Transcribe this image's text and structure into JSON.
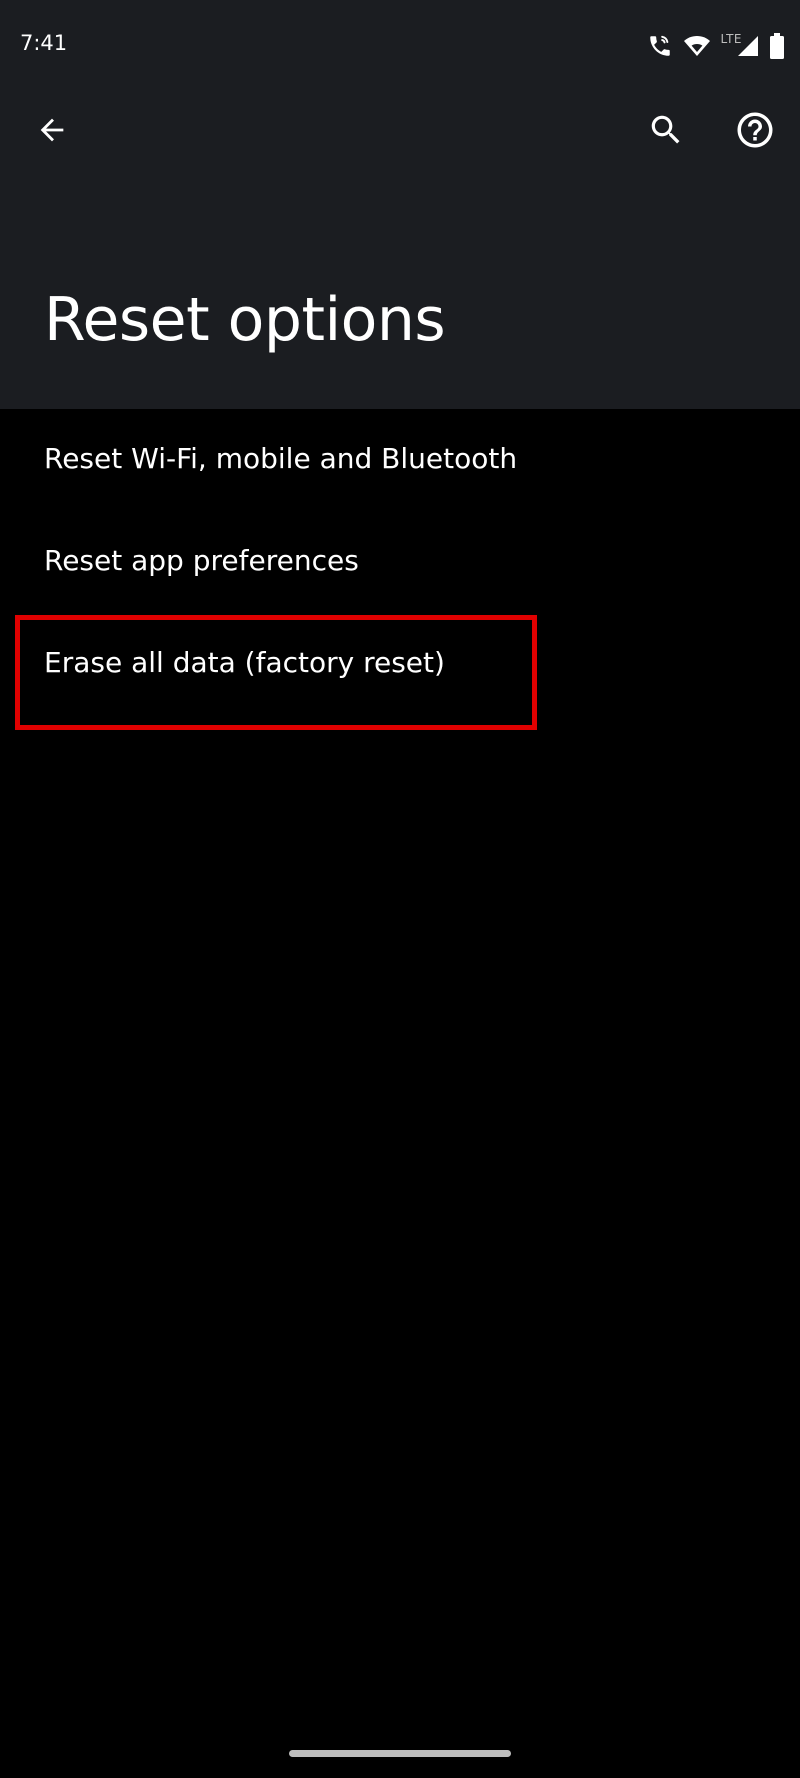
{
  "status_bar": {
    "time": "7:41",
    "network_type": "LTE",
    "icons": [
      "wifi-calling-icon",
      "wifi-icon",
      "cell-signal-icon",
      "battery-icon"
    ]
  },
  "toolbar": {
    "back_icon": "arrow-left-icon",
    "search_icon": "search-icon",
    "help_icon": "help-circle-icon"
  },
  "page": {
    "title": "Reset options"
  },
  "items": [
    {
      "label": "Reset Wi-Fi, mobile and Bluetooth"
    },
    {
      "label": "Reset app preferences"
    },
    {
      "label": "Erase all data (factory reset)"
    }
  ],
  "highlight": {
    "color": "#e00000",
    "target": "Erase all data (factory reset)"
  },
  "colors": {
    "header_background": "#1b1d21",
    "content_background": "#000000",
    "text": "#ffffff"
  }
}
